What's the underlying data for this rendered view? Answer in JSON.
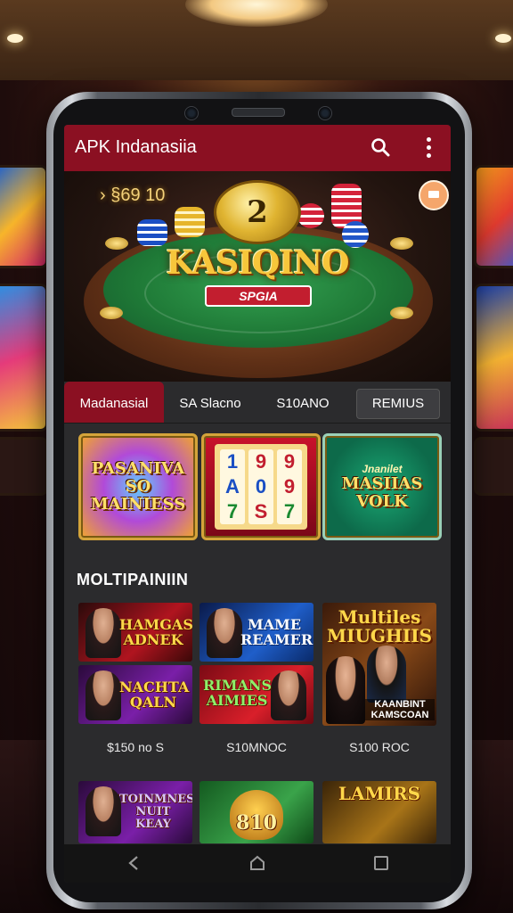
{
  "app": {
    "title": "APK Indanasiia"
  },
  "hero": {
    "sign_text": "› §69 10",
    "coin_number": "2",
    "logo_text": "KASIQINO",
    "sub_label": "SPGIA"
  },
  "tabs": [
    {
      "label": "Madanasial",
      "active": true
    },
    {
      "label": "SA Slacno",
      "active": false
    },
    {
      "label": "S10ANO",
      "active": false
    },
    {
      "label": "REMIUS",
      "active": false
    }
  ],
  "featured": [
    {
      "title": "PASANIVA SO MAINIESS"
    },
    {
      "reels": [
        "1",
        "A",
        "7",
        "9",
        "0",
        "S",
        "9",
        "9",
        "7"
      ]
    },
    {
      "small": "Jnanilet",
      "title": "MASIIAS VOLK"
    }
  ],
  "section": {
    "title": "MOLTIPAINIIN"
  },
  "games": [
    {
      "title": "HAMGAS ADNEK"
    },
    {
      "title": "MAME REAMER"
    },
    {
      "title": "NACHTA QALN"
    },
    {
      "title": "RIMANS AIMIES"
    },
    {
      "title": "Multiles MIUGHIIS",
      "subtitle": "KAANBINT KAMSCOAN"
    },
    {
      "title": "TOINMNES NUIT KEAY"
    },
    {
      "title": "810"
    },
    {
      "title": "LAMIRS"
    }
  ],
  "prices": [
    "$150 no S",
    "S10MNOC",
    "S100 ROC"
  ],
  "colors": {
    "accent": "#8b1022",
    "background": "#2b2b2d"
  }
}
